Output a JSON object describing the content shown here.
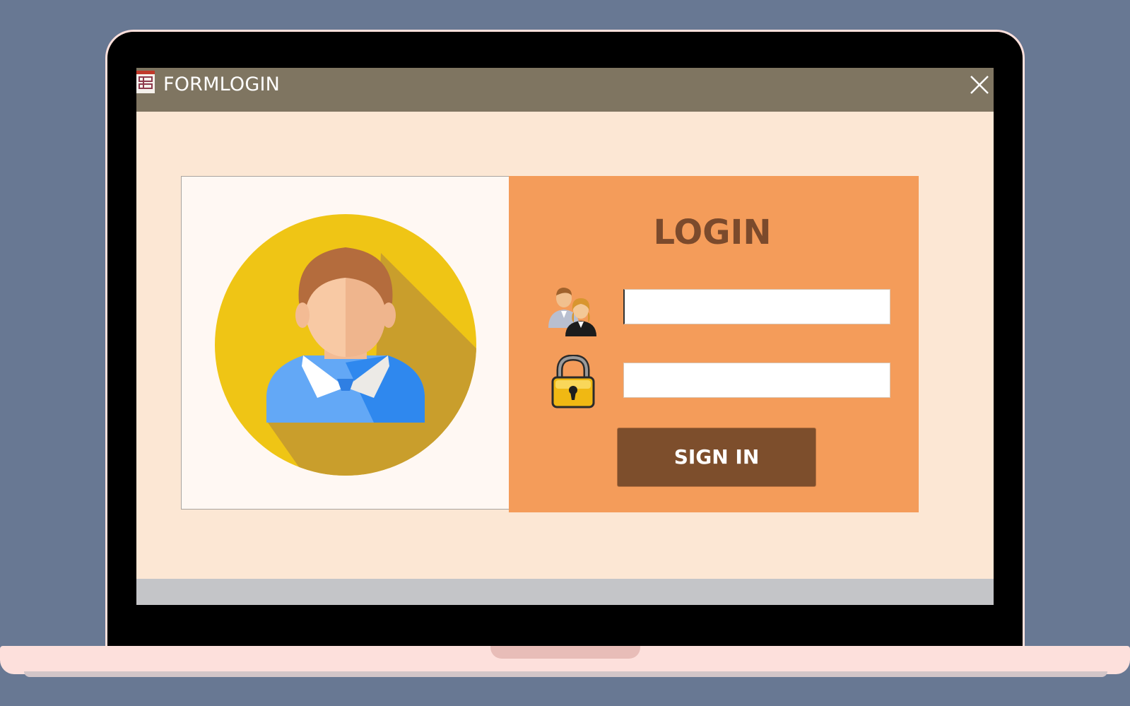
{
  "window": {
    "title": "FORMLOGIN",
    "icon": "form-icon",
    "close_icon": "close-icon"
  },
  "login": {
    "heading": "LOGIN",
    "username_icon": "users-icon",
    "username_value": "",
    "password_icon": "lock-icon",
    "password_value": "",
    "signin_label": "SIGN IN"
  },
  "colors": {
    "background": "#687893",
    "titlebar": "#7f7561",
    "form_body": "#fce7d4",
    "login_panel": "#f49c5a",
    "heading": "#7b4a2c",
    "signin_button": "#7d4e2c",
    "avatar_circle": "#efc515"
  }
}
